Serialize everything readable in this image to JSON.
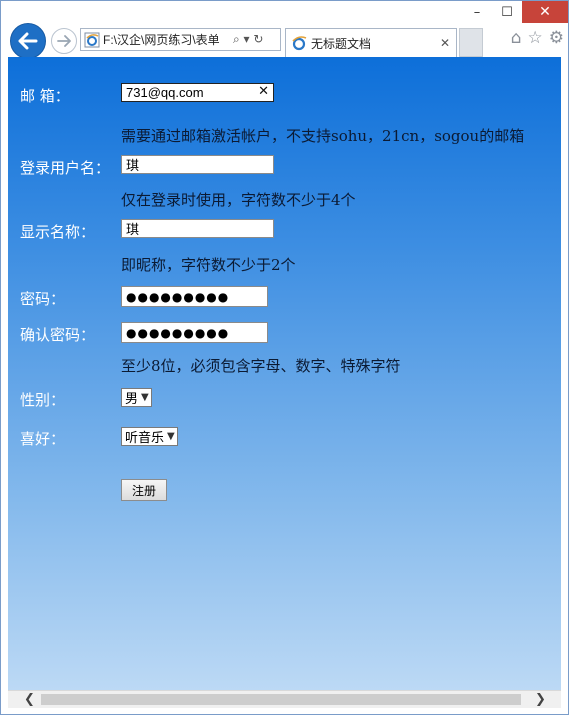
{
  "window": {
    "controls": {
      "minimize": "–",
      "maximize": "☐",
      "close": "✕"
    }
  },
  "browser": {
    "address": "F:\\汉企\\网页练习\\表单",
    "address_tools": "⌕ ▾ ↻",
    "tab_title": "无标题文档",
    "tab_close": "✕"
  },
  "form": {
    "email": {
      "label": "邮  箱：",
      "value": "731@qq.com",
      "clear": "✕",
      "hint": "需要通过邮箱激活帐户，不支持sohu，21cn，sogou的邮箱"
    },
    "username": {
      "label": "登录用户名：",
      "value": "琪",
      "hint": "仅在登录时使用，字符数不少于4个"
    },
    "display_name": {
      "label": "显示名称：",
      "value": "琪",
      "hint": "即昵称，字符数不少于2个"
    },
    "password": {
      "label": "密码：",
      "value": "●●●●●●●●●"
    },
    "confirm_password": {
      "label": "确认密码：",
      "value": "●●●●●●●●●",
      "hint": "至少8位，必须包含字母、数字、特殊字符"
    },
    "gender": {
      "label": "性别：",
      "selected": "男"
    },
    "hobby": {
      "label": "喜好：",
      "selected": "听音乐"
    },
    "submit_label": "注册"
  },
  "colors": {
    "content_top": "#0d6fd9",
    "content_bottom": "#bcd9f5",
    "label_text": "#ffffff",
    "hint_text": "#0b1a33",
    "close_button": "#c7443a"
  },
  "icons": [
    "back-arrow-icon",
    "forward-arrow-icon",
    "ie-page-icon",
    "home-icon",
    "favorites-star-icon",
    "settings-gear-icon"
  ]
}
